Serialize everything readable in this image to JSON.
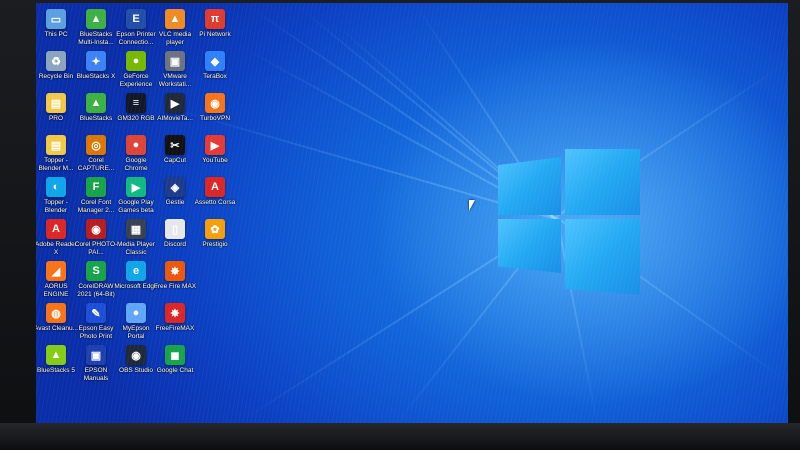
{
  "desktop": {
    "icons": [
      {
        "label": "This PC",
        "glyph": "▭",
        "color": "#5aa0e0"
      },
      {
        "label": "BlueStacks Multi-Insta...",
        "glyph": "▲",
        "color": "#3cb043"
      },
      {
        "label": "Epson Printer Connectio...",
        "glyph": "E",
        "color": "#1f4fa8"
      },
      {
        "label": "VLC media player",
        "glyph": "▲",
        "color": "#f08a24"
      },
      {
        "label": "Pi Network",
        "glyph": "π",
        "color": "#e03a2f"
      },
      {
        "label": "Recycle Bin",
        "glyph": "♻",
        "color": "#8aa4c0"
      },
      {
        "label": "BlueStacks X",
        "glyph": "✦",
        "color": "#3b82f6"
      },
      {
        "label": "GeForce Experience",
        "glyph": "●",
        "color": "#76b900"
      },
      {
        "label": "VMware Workstati...",
        "glyph": "▣",
        "color": "#6b7280"
      },
      {
        "label": "TeraBox",
        "glyph": "◆",
        "color": "#2f7fff"
      },
      {
        "label": "PRO",
        "glyph": "▤",
        "color": "#f2c744"
      },
      {
        "label": "BlueStacks",
        "glyph": "▲",
        "color": "#3cb043"
      },
      {
        "label": "GM320 RGB",
        "glyph": "≡",
        "color": "#111827"
      },
      {
        "label": "AIMovieTa...",
        "glyph": "▶",
        "color": "#1f2937"
      },
      {
        "label": "TurboVPN",
        "glyph": "◉",
        "color": "#f97316"
      },
      {
        "label": "Topper - Blender M...",
        "glyph": "▤",
        "color": "#f2c744"
      },
      {
        "label": "Corel CAPTURE...",
        "glyph": "◎",
        "color": "#d97706"
      },
      {
        "label": "Google Chrome",
        "glyph": "●",
        "color": "#db4437"
      },
      {
        "label": "CapCut",
        "glyph": "✂",
        "color": "#111111"
      },
      {
        "label": "YouTube",
        "glyph": "▶",
        "color": "#e53935"
      },
      {
        "label": "Topper - Blender",
        "glyph": "◐",
        "color": "#0ea5e9"
      },
      {
        "label": "Corel Font Manager 2...",
        "glyph": "F",
        "color": "#16a34a"
      },
      {
        "label": "Google Play Games beta",
        "glyph": "▶",
        "color": "#10b981"
      },
      {
        "label": "Gestie",
        "glyph": "◈",
        "color": "#1e3a8a"
      },
      {
        "label": "Assetto Corsa",
        "glyph": "A",
        "color": "#dc2626"
      },
      {
        "label": "Adobe Reader X",
        "glyph": "A",
        "color": "#dc2626"
      },
      {
        "label": "Corel PHOTO-PAI...",
        "glyph": "◉",
        "color": "#b91c1c"
      },
      {
        "label": "Media Player Classic",
        "glyph": "▦",
        "color": "#374151"
      },
      {
        "label": "Discord",
        "glyph": "▯",
        "color": "#e5e7eb"
      },
      {
        "label": "Prestigio",
        "glyph": "✿",
        "color": "#f59e0b"
      },
      {
        "label": "AORUS ENGINE",
        "glyph": "◢",
        "color": "#f97316"
      },
      {
        "label": "CorelDRAW 2021 (64-Bit)",
        "glyph": "S",
        "color": "#16a34a"
      },
      {
        "label": "Microsoft Edge",
        "glyph": "e",
        "color": "#0ea5e9"
      },
      {
        "label": "Free Fire MAX",
        "glyph": "✸",
        "color": "#ea580c"
      },
      {
        "label": "Avast Cleanu...",
        "glyph": "◍",
        "color": "#f97316"
      },
      {
        "label": "Epson Easy Photo Print",
        "glyph": "✎",
        "color": "#1d4ed8"
      },
      {
        "label": "MyEpson Portal",
        "glyph": "●",
        "color": "#60a5fa"
      },
      {
        "label": "FreeFireMAX",
        "glyph": "✸",
        "color": "#dc2626"
      },
      {
        "label": "BlueStacks 5",
        "glyph": "▲",
        "color": "#84cc16"
      },
      {
        "label": "EPSON Manuals",
        "glyph": "▣",
        "color": "#1e40af"
      },
      {
        "label": "OBS Studio",
        "glyph": "◉",
        "color": "#1f2937"
      },
      {
        "label": "Google Chat",
        "glyph": "◼",
        "color": "#16a34a"
      }
    ]
  }
}
